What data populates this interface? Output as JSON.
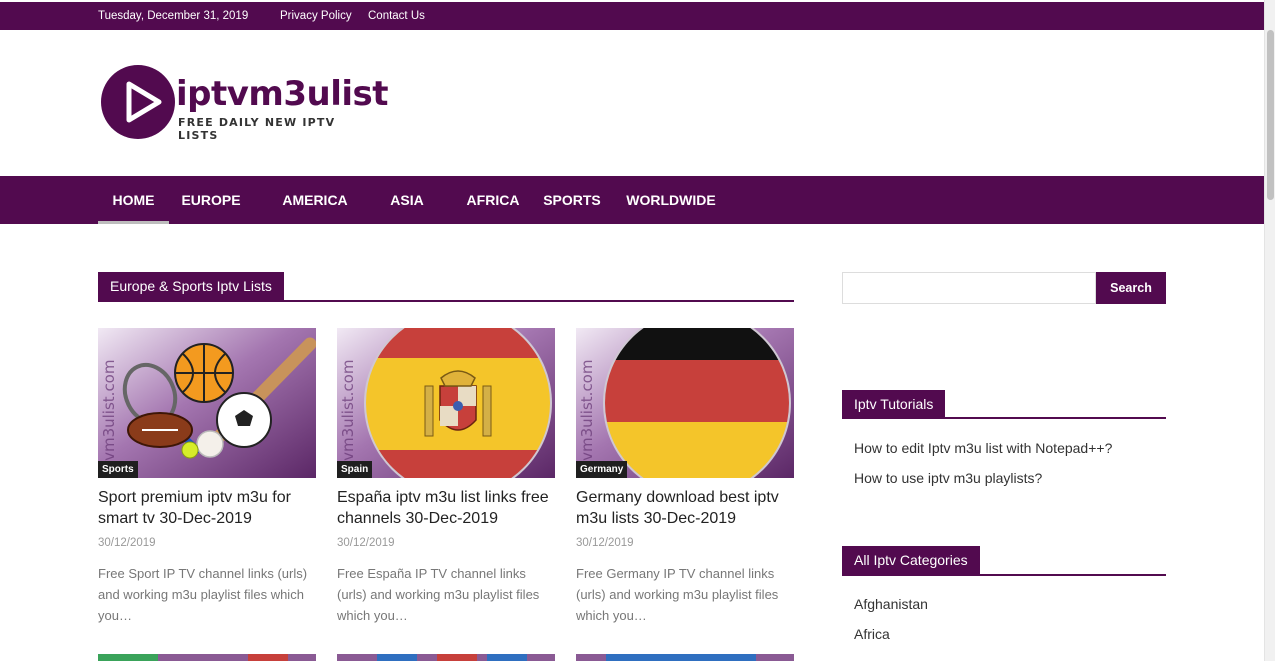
{
  "topbar": {
    "date": "Tuesday, December 31, 2019",
    "links": [
      "Privacy Policy",
      "Contact Us"
    ]
  },
  "logo": {
    "name": "iptvm3ulist",
    "tagline": "FREE DAILY NEW IPTV LISTS",
    "brand_color": "#520a4f"
  },
  "nav": {
    "items": [
      "HOME",
      "EUROPE",
      "AMERICA",
      "ASIA",
      "AFRICA",
      "SPORTS",
      "WORLDWIDE"
    ],
    "active": "HOME"
  },
  "main": {
    "section_title": "Europe & Sports Iptv Lists",
    "posts": [
      {
        "category": "Sports",
        "title": "Sport premium iptv m3u for smart tv 30-Dec-2019",
        "date": "30/12/2019",
        "excerpt": "Free Sport IP TV channel links (urls) and working m3u playlist files which you…",
        "watermark": "iptvm3ulist.com"
      },
      {
        "category": "Spain",
        "title": "España iptv m3u list links free channels 30-Dec-2019",
        "date": "30/12/2019",
        "excerpt": "Free España IP TV channel links (urls) and working m3u playlist files which you…",
        "watermark": "iptvm3ulist.com"
      },
      {
        "category": "Germany",
        "title": "Germany download best iptv m3u lists 30-Dec-2019",
        "date": "30/12/2019",
        "excerpt": "Free Germany IP TV channel links (urls) and working m3u playlist files which you…",
        "watermark": "iptvm3ulist.com"
      }
    ]
  },
  "sidebar": {
    "search": {
      "value": "",
      "button_label": "Search"
    },
    "tutorials": {
      "title": "Iptv Tutorials",
      "links": [
        "How to edit Iptv m3u list with Notepad++?",
        "How to use iptv m3u playlists?"
      ]
    },
    "categories": {
      "title": "All Iptv Categories",
      "links": [
        "Afghanistan",
        "Africa"
      ]
    }
  }
}
